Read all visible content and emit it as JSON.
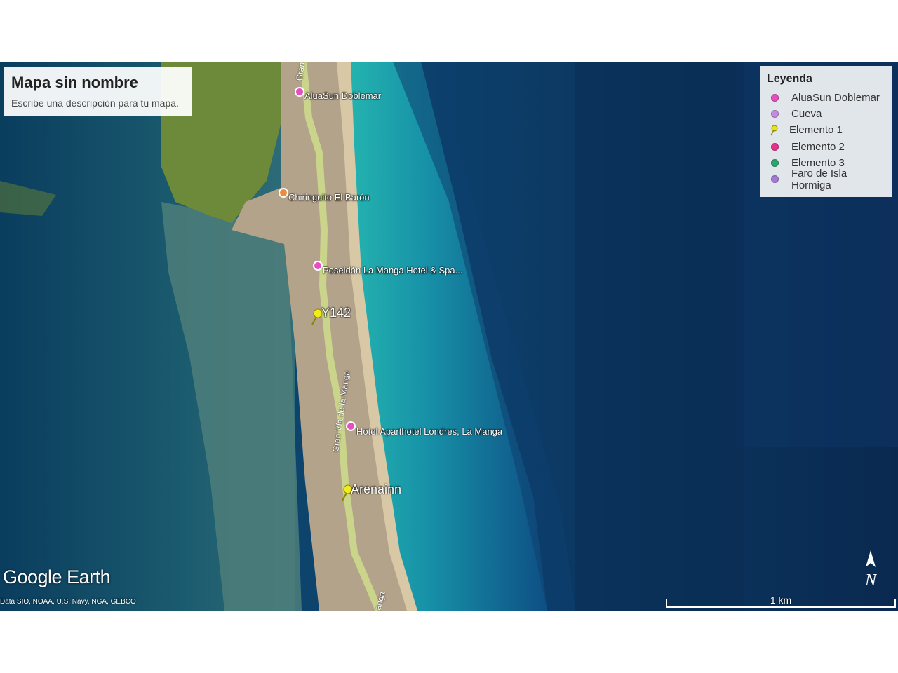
{
  "info": {
    "title": "Mapa sin nombre",
    "description": "Escribe una descripción para tu mapa."
  },
  "legend": {
    "title": "Leyenda",
    "items": [
      {
        "label": "AluaSun Doblemar",
        "icon": "pink-dot",
        "color": "#e64fc0"
      },
      {
        "label": "Cueva",
        "icon": "lilac-dot",
        "color": "#c68be0"
      },
      {
        "label": "Elemento 1",
        "icon": "yellow-pushpin",
        "color": "#e8e21a"
      },
      {
        "label": "Elemento 2",
        "icon": "magenta-dot",
        "color": "#e0358f"
      },
      {
        "label": "Elemento 3",
        "icon": "green-dot",
        "color": "#2fa46f"
      },
      {
        "label": "Faro de Isla Hormiga",
        "icon": "purple-dot",
        "color": "#a57ad6"
      }
    ]
  },
  "places": {
    "alua": "AluaSun Doblemar",
    "chiringuito": "Chiringuito El Barón",
    "poseidon": "Poseidón La Manga Hotel & Spa...",
    "y142": "Y142",
    "londres": "Hotel Aparthotel Londres, La Manga",
    "arenainn": "Arenainn"
  },
  "roads": {
    "gran_via_1": "Gran Vía de la Manga",
    "gran_via_top": "Gran",
    "gran_via_bottom": "anga"
  },
  "brand": "Google Earth",
  "attribution": "Data SIO, NOAA, U.S. Navy, NGA, GEBCO",
  "scale": "1 km",
  "north_label": "N"
}
